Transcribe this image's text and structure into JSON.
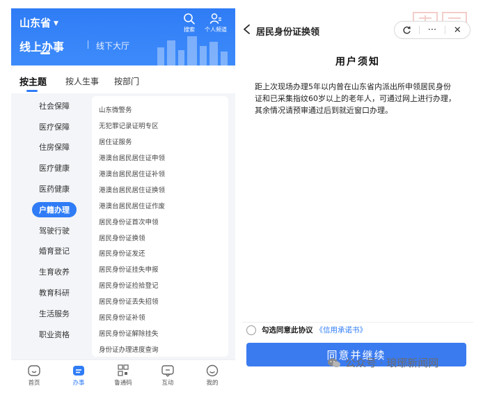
{
  "left_app": {
    "province": "山东省",
    "top_icons": [
      {
        "label": "搜索",
        "icon": "search-icon"
      },
      {
        "label": "个人频道",
        "icon": "person-icon"
      }
    ],
    "hero_title": "线上办事",
    "hero_subtitle": "线下大厅",
    "tabs": [
      "按主题",
      "按人生事",
      "按部门"
    ],
    "categories": [
      "社会保障",
      "医疗保障",
      "住房保障",
      "医疗健康",
      "医药健康",
      "户籍办理",
      "驾驶行驶",
      "婚育登记",
      "生育收养",
      "教育科研",
      "生活服务",
      "职业资格"
    ],
    "active_category": "户籍办理",
    "services": [
      "山东微警务",
      "无犯罪记录证明专区",
      "居住证服务",
      "港澳台居民居住证申领",
      "港澳台居民居住证补领",
      "港澳台居民居住证换领",
      "港澳台居民居住证作废",
      "居民身份证首次申领",
      "居民身份证换领",
      "居民身份证发还",
      "居民身份证挂失申报",
      "居民身份证捡拾登记",
      "居民身份证丢失招领",
      "居民身份证补领",
      "居民身份证解除挂失",
      "身份证办理进度查询"
    ],
    "bottom_nav": [
      {
        "label": "首页",
        "icon": "home-icon"
      },
      {
        "label": "办事",
        "icon": "briefcase-icon"
      },
      {
        "label": "鲁通码",
        "icon": "qr-code-icon"
      },
      {
        "label": "互动",
        "icon": "chat-icon"
      },
      {
        "label": "我的",
        "icon": "user-icon"
      }
    ],
    "accent_color": "#2f7cf6"
  },
  "right_app": {
    "page_title": "居民身份证换领",
    "notice_title": "用户须知",
    "notice_body": "距上次现场办理5年以内曾在山东省内派出所申领居民身份证和已采集指纹60岁以上的老年人，可通过网上进行办理，其余情况请预审通过后到就近窗口办理。",
    "agree_label": "勾选同意此协议",
    "agree_link": "《信用承诺书》",
    "continue_button": "同意并继续",
    "button_color": "#3a7bf0"
  },
  "watermark": "公众号 · 琅琊新闻网"
}
